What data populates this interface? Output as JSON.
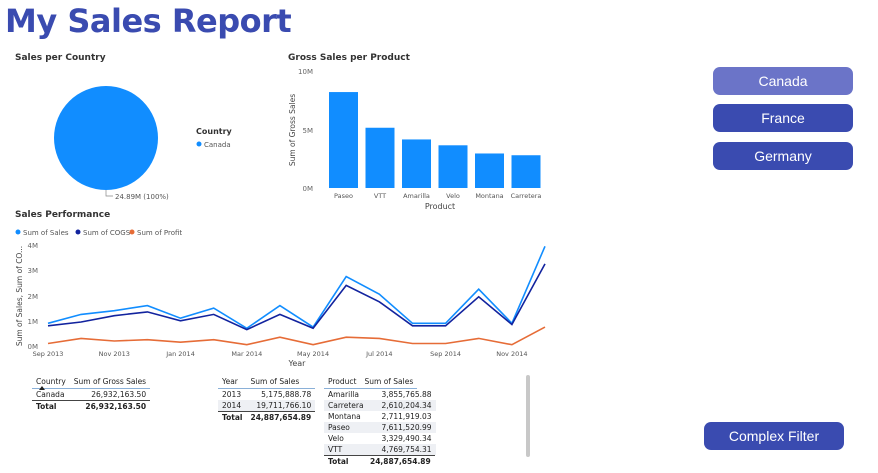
{
  "title": "My Sales Report",
  "colors": {
    "title": "#3a4bb0",
    "sales": "#118dff",
    "cogs": "#12239e",
    "profit": "#e66c37",
    "slicer_selected": "#6b74c8",
    "slicer": "#3a4bb0"
  },
  "pie": {
    "title": "Sales per Country",
    "legend_title": "Country",
    "legend_items": [
      "Canada"
    ],
    "label": "24.89M (100%)"
  },
  "bar": {
    "title": "Gross Sales per Product",
    "ylabel": "Sum of Gross Sales",
    "xlabel": "Product",
    "yticks": [
      "10M",
      "5M",
      "0M"
    ]
  },
  "line": {
    "title": "Sales Performance",
    "legend": [
      "Sum of  Sales",
      "Sum of COGS",
      "Sum of Profit"
    ],
    "ylabel": "Sum of Sales, Sum of CO...",
    "xlabel": "Year",
    "yticks": [
      "4M",
      "3M",
      "2M",
      "1M",
      "0M"
    ],
    "xticks": [
      "Sep 2013",
      "Nov 2013",
      "Jan 2014",
      "Mar 2014",
      "May 2014",
      "Jul 2014",
      "Sep 2014",
      "Nov 2014"
    ]
  },
  "slicer": {
    "items": [
      "Canada",
      "France",
      "Germany"
    ],
    "selected": "Canada"
  },
  "complex_filter_label": "Complex Filter",
  "table_country": {
    "headers": [
      "Country",
      "Sum of Gross Sales"
    ],
    "rows": [
      [
        "Canada",
        "26,932,163.50"
      ]
    ],
    "total": [
      "Total",
      "26,932,163.50"
    ]
  },
  "table_year": {
    "headers": [
      "Year",
      "Sum of Sales"
    ],
    "rows": [
      [
        "2013",
        "5,175,888.78"
      ],
      [
        "2014",
        "19,711,766.10"
      ]
    ],
    "total": [
      "Total",
      "24,887,654.89"
    ]
  },
  "table_product": {
    "headers": [
      "Product",
      "Sum of Sales"
    ],
    "rows": [
      [
        "Amarilla",
        "3,855,765.88"
      ],
      [
        "Carretera",
        "2,610,204.34"
      ],
      [
        "Montana",
        "2,711,919.03"
      ],
      [
        "Paseo",
        "7,611,520.99"
      ],
      [
        "Velo",
        "3,329,490.34"
      ],
      [
        "VTT",
        "4,769,754.31"
      ]
    ],
    "total": [
      "Total",
      "24,887,654.89"
    ]
  },
  "chart_data": [
    {
      "type": "pie",
      "title": "Sales per Country",
      "categories": [
        "Canada"
      ],
      "values": [
        24890000
      ],
      "legend": "Country"
    },
    {
      "type": "bar",
      "title": "Gross Sales per Product",
      "categories": [
        "Paseo",
        "VTT",
        "Amarilla",
        "Velo",
        "Montana",
        "Carretera"
      ],
      "values": [
        8200000,
        5150000,
        4150000,
        3650000,
        2950000,
        2800000
      ],
      "xlabel": "Product",
      "ylabel": "Sum of Gross Sales",
      "ylim": [
        0,
        10000000
      ]
    },
    {
      "type": "line",
      "title": "Sales Performance",
      "x": [
        "2013-09",
        "2013-10",
        "2013-11",
        "2013-12",
        "2014-01",
        "2014-02",
        "2014-03",
        "2014-04",
        "2014-05",
        "2014-06",
        "2014-07",
        "2014-08",
        "2014-09",
        "2014-10",
        "2014-11",
        "2014-12"
      ],
      "series": [
        {
          "name": "Sum of  Sales",
          "values": [
            900000,
            1250000,
            1400000,
            1600000,
            1100000,
            1500000,
            700000,
            1600000,
            750000,
            2750000,
            2050000,
            900000,
            900000,
            2250000,
            900000,
            3950000
          ]
        },
        {
          "name": "Sum of COGS",
          "values": [
            800000,
            950000,
            1200000,
            1350000,
            1000000,
            1250000,
            650000,
            1250000,
            700000,
            2400000,
            1750000,
            800000,
            800000,
            1950000,
            850000,
            3250000
          ]
        },
        {
          "name": "Sum of Profit",
          "values": [
            100000,
            300000,
            200000,
            250000,
            150000,
            250000,
            50000,
            350000,
            50000,
            350000,
            300000,
            100000,
            100000,
            300000,
            50000,
            750000
          ]
        }
      ],
      "xlabel": "Year",
      "ylabel": "Sum of Sales, Sum of CO...",
      "ylim": [
        0,
        4000000
      ]
    }
  ]
}
